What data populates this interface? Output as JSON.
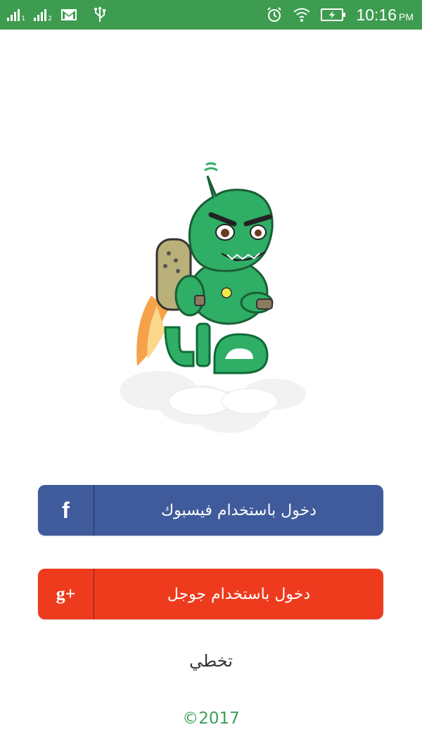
{
  "status_bar": {
    "sim1_label": "1",
    "sim2_label": "2",
    "time": "10:16",
    "ampm": "PM",
    "icons": [
      "signal-sim1-icon",
      "signal-sim2-icon",
      "gmail-icon",
      "usb-icon",
      "alarm-icon",
      "wifi-icon",
      "battery-charging-icon"
    ]
  },
  "logo": {
    "text": "صارد",
    "name": "mascot-logo"
  },
  "buttons": {
    "facebook": {
      "label": "دخول باستخدام فيسبوك",
      "icon": "facebook-icon",
      "glyph": "f",
      "color": "#3f5b9b"
    },
    "google": {
      "label": "دخول باستخدام جوجل",
      "icon": "google-plus-icon",
      "glyph": "g+",
      "color": "#ee3b1e"
    }
  },
  "skip_label": "تخطي",
  "copyright": "©2017",
  "colors": {
    "status_bar": "#3d9c4f",
    "accent_green": "#3f9e58"
  }
}
